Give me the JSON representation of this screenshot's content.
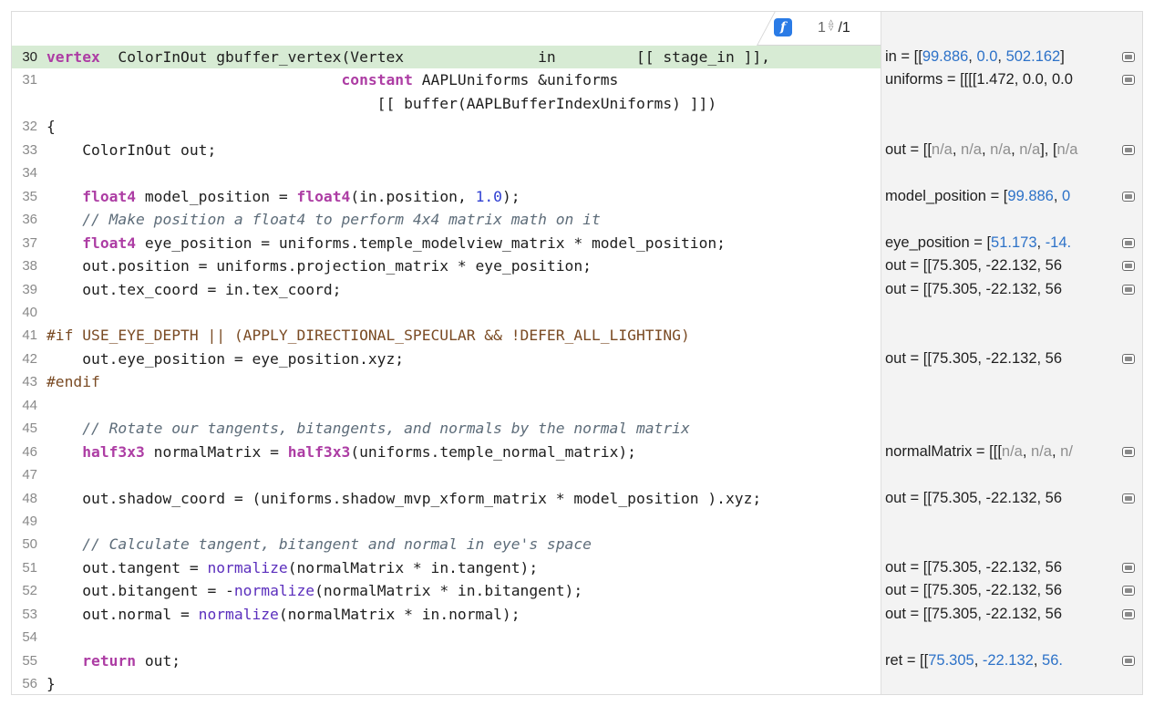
{
  "header": {
    "function_badge": "f",
    "page_current": "1",
    "page_total": "/1",
    "stepper_up": "▵",
    "stepper_down": "▿"
  },
  "editor": {
    "current_line": 30,
    "lines": [
      {
        "n": "30",
        "current": true,
        "tokens": [
          [
            "kw",
            "vertex"
          ],
          [
            "",
            "  ColorInOut gbuffer_vertex(Vertex               in         [[ stage_in ]],"
          ]
        ]
      },
      {
        "n": "31",
        "tokens": [
          [
            "",
            "                                 "
          ],
          [
            "kw",
            "constant"
          ],
          [
            "",
            " AAPLUniforms &uniforms"
          ]
        ]
      },
      {
        "n": "",
        "tokens": [
          [
            "",
            "                                     [[ buffer(AAPLBufferIndexUniforms) ]])"
          ]
        ]
      },
      {
        "n": "32",
        "tokens": [
          [
            "",
            "{"
          ]
        ]
      },
      {
        "n": "33",
        "tokens": [
          [
            "",
            "    ColorInOut out;"
          ]
        ]
      },
      {
        "n": "34",
        "tokens": []
      },
      {
        "n": "35",
        "tokens": [
          [
            "",
            "    "
          ],
          [
            "kw",
            "float4"
          ],
          [
            "",
            " model_position = "
          ],
          [
            "kw",
            "float4"
          ],
          [
            "",
            "(in.position, "
          ],
          [
            "num",
            "1.0"
          ],
          [
            "",
            ");"
          ]
        ]
      },
      {
        "n": "36",
        "tokens": [
          [
            "",
            "    "
          ],
          [
            "cm",
            "// Make position a float4 to perform 4x4 matrix math on it"
          ]
        ]
      },
      {
        "n": "37",
        "tokens": [
          [
            "",
            "    "
          ],
          [
            "kw",
            "float4"
          ],
          [
            "",
            " eye_position = uniforms.temple_modelview_matrix * model_position;"
          ]
        ]
      },
      {
        "n": "38",
        "tokens": [
          [
            "",
            "    out.position = uniforms.projection_matrix * eye_position;"
          ]
        ]
      },
      {
        "n": "39",
        "tokens": [
          [
            "",
            "    out.tex_coord = in.tex_coord;"
          ]
        ]
      },
      {
        "n": "40",
        "tokens": []
      },
      {
        "n": "41",
        "tokens": [
          [
            "pp",
            "#if USE_EYE_DEPTH || (APPLY_DIRECTIONAL_SPECULAR && !DEFER_ALL_LIGHTING)"
          ]
        ]
      },
      {
        "n": "42",
        "tokens": [
          [
            "",
            "    out.eye_position = eye_position.xyz;"
          ]
        ]
      },
      {
        "n": "43",
        "tokens": [
          [
            "pp",
            "#endif"
          ]
        ]
      },
      {
        "n": "44",
        "tokens": []
      },
      {
        "n": "45",
        "tokens": [
          [
            "",
            "    "
          ],
          [
            "cm",
            "// Rotate our tangents, bitangents, and normals by the normal matrix"
          ]
        ]
      },
      {
        "n": "46",
        "tokens": [
          [
            "",
            "    "
          ],
          [
            "kw",
            "half3x3"
          ],
          [
            "",
            " normalMatrix = "
          ],
          [
            "kw",
            "half3x3"
          ],
          [
            "",
            "(uniforms.temple_normal_matrix);"
          ]
        ]
      },
      {
        "n": "47",
        "tokens": []
      },
      {
        "n": "48",
        "tokens": [
          [
            "",
            "    out.shadow_coord = (uniforms.shadow_mvp_xform_matrix * model_position ).xyz;"
          ]
        ]
      },
      {
        "n": "49",
        "tokens": []
      },
      {
        "n": "50",
        "tokens": [
          [
            "",
            "    "
          ],
          [
            "cm",
            "// Calculate tangent, bitangent and normal in eye's space"
          ]
        ]
      },
      {
        "n": "51",
        "tokens": [
          [
            "",
            "    out.tangent = "
          ],
          [
            "fn",
            "normalize"
          ],
          [
            "",
            "(normalMatrix * in.tangent);"
          ]
        ]
      },
      {
        "n": "52",
        "tokens": [
          [
            "",
            "    out.bitangent = -"
          ],
          [
            "fn",
            "normalize"
          ],
          [
            "",
            "(normalMatrix * in.bitangent);"
          ]
        ]
      },
      {
        "n": "53",
        "tokens": [
          [
            "",
            "    out.normal = "
          ],
          [
            "fn",
            "normalize"
          ],
          [
            "",
            "(normalMatrix * in.normal);"
          ]
        ]
      },
      {
        "n": "54",
        "tokens": []
      },
      {
        "n": "55",
        "tokens": [
          [
            "",
            "    "
          ],
          [
            "kw",
            "return"
          ],
          [
            "",
            " out;"
          ]
        ]
      },
      {
        "n": "56",
        "tokens": [
          [
            "",
            "}"
          ]
        ]
      }
    ]
  },
  "results": [
    {
      "row": 0,
      "parts": [
        [
          "",
          "in = [["
        ],
        [
          "hv",
          "99.886"
        ],
        [
          "",
          ", "
        ],
        [
          "hv",
          "0.0"
        ],
        [
          "",
          ", "
        ],
        [
          "hv",
          "502.162"
        ],
        [
          "",
          "]"
        ]
      ]
    },
    {
      "row": 1,
      "parts": [
        [
          "",
          "uniforms = [[[[1.472, 0.0, 0.0"
        ]
      ]
    },
    {
      "row": 4,
      "parts": [
        [
          "",
          "out = [["
        ],
        [
          "gv",
          "n/a"
        ],
        [
          "",
          ", "
        ],
        [
          "gv",
          "n/a"
        ],
        [
          "",
          ", "
        ],
        [
          "gv",
          "n/a"
        ],
        [
          "",
          ", "
        ],
        [
          "gv",
          "n/a"
        ],
        [
          "",
          "], ["
        ],
        [
          "gv",
          "n/a"
        ]
      ]
    },
    {
      "row": 6,
      "parts": [
        [
          "",
          "model_position = ["
        ],
        [
          "hv",
          "99.886"
        ],
        [
          "",
          ", "
        ],
        [
          "hv",
          "0"
        ]
      ]
    },
    {
      "row": 8,
      "parts": [
        [
          "",
          "eye_position = ["
        ],
        [
          "hv",
          "51.173"
        ],
        [
          "",
          ", "
        ],
        [
          "hv",
          "-14."
        ]
      ]
    },
    {
      "row": 9,
      "parts": [
        [
          "",
          "out = [[75.305, -22.132, 56"
        ]
      ]
    },
    {
      "row": 10,
      "parts": [
        [
          "",
          "out = [[75.305, -22.132, 56"
        ]
      ]
    },
    {
      "row": 13,
      "parts": [
        [
          "",
          "out = [[75.305, -22.132, 56"
        ]
      ]
    },
    {
      "row": 17,
      "parts": [
        [
          "",
          "normalMatrix = [[["
        ],
        [
          "gv",
          "n/a"
        ],
        [
          "",
          ", "
        ],
        [
          "gv",
          "n/a"
        ],
        [
          "",
          ", "
        ],
        [
          "gv",
          "n/"
        ]
      ]
    },
    {
      "row": 19,
      "parts": [
        [
          "",
          "out = [[75.305, -22.132, 56"
        ]
      ]
    },
    {
      "row": 22,
      "parts": [
        [
          "",
          "out = [[75.305, -22.132, 56"
        ]
      ]
    },
    {
      "row": 23,
      "parts": [
        [
          "",
          "out = [[75.305, -22.132, 56"
        ]
      ]
    },
    {
      "row": 24,
      "parts": [
        [
          "",
          "out = [[75.305, -22.132, 56"
        ]
      ]
    },
    {
      "row": 26,
      "parts": [
        [
          "",
          "ret = [["
        ],
        [
          "hv",
          "75.305"
        ],
        [
          "",
          ", "
        ],
        [
          "hv",
          "-22.132"
        ],
        [
          "",
          ", "
        ],
        [
          "hv",
          "56."
        ]
      ]
    }
  ],
  "icons": {
    "quicklook": "quick-look-icon"
  },
  "colors": {
    "current_line_bg": "#d7ebd4",
    "keyword": "#ad3da4",
    "function": "#5b2fbd",
    "number": "#2f3fd2",
    "comment": "#5d6c79",
    "preprocessor": "#7a4b24",
    "result_value": "#2d72c8",
    "badge": "#2a7be6"
  }
}
